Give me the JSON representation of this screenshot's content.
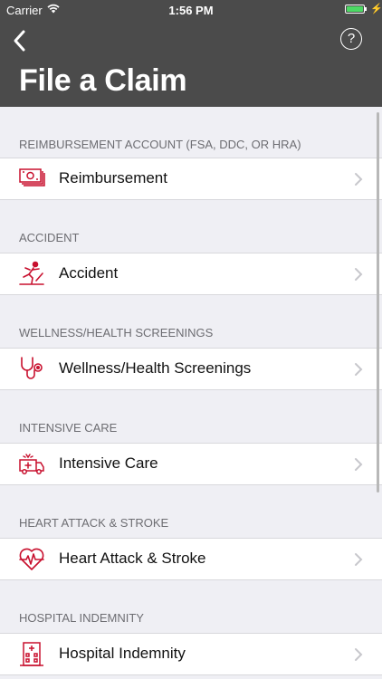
{
  "status_bar": {
    "carrier": "Carrier",
    "time": "1:56 PM",
    "battery_pct": 1.0
  },
  "header": {
    "title": "File a Claim",
    "help_label": "?"
  },
  "colors": {
    "header_bg": "#4b4b4b",
    "icon_accent": "#c8102e",
    "battery": "#4cd964"
  },
  "sections": [
    {
      "header": "REIMBURSEMENT ACCOUNT (FSA, DDC, OR HRA)",
      "item": "Reimbursement",
      "icon": "money-icon"
    },
    {
      "header": "ACCIDENT",
      "item": "Accident",
      "icon": "falling-person-icon"
    },
    {
      "header": "WELLNESS/HEALTH SCREENINGS",
      "item": "Wellness/Health Screenings",
      "icon": "stethoscope-icon"
    },
    {
      "header": "INTENSIVE CARE",
      "item": "Intensive Care",
      "icon": "ambulance-icon"
    },
    {
      "header": "HEART ATTACK & STROKE",
      "item": "Heart Attack & Stroke",
      "icon": "heart-pulse-icon"
    },
    {
      "header": "HOSPITAL INDEMNITY",
      "item": "Hospital Indemnity",
      "icon": "hospital-icon"
    }
  ]
}
